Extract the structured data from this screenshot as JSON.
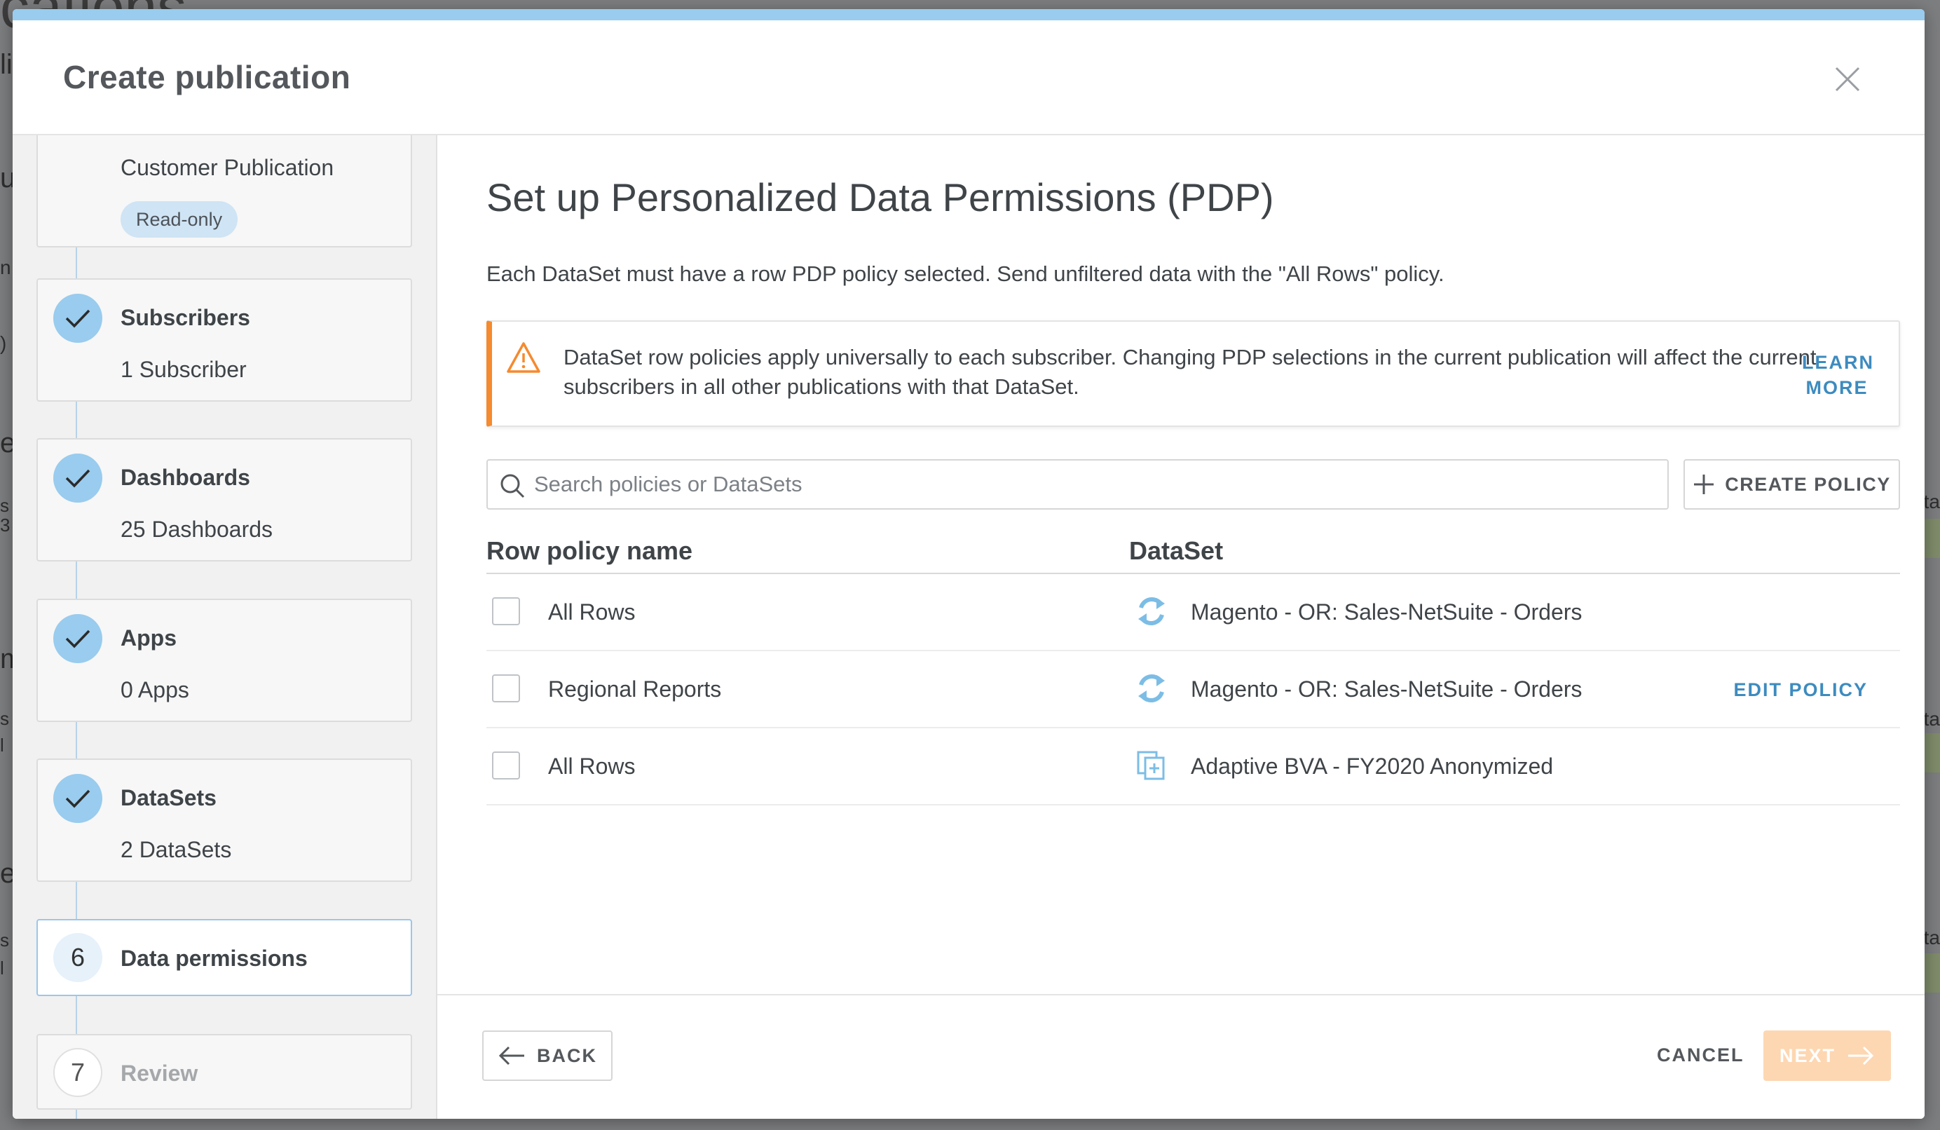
{
  "background": {
    "title_fragment": "cations",
    "side_fragments": [
      "li",
      "us",
      "n",
      ")",
      "e",
      "s",
      "3",
      "m",
      "s",
      "l",
      "el",
      "s",
      "l"
    ],
    "right_fragments": [
      "ta",
      "ld",
      "ta",
      "ld",
      "ta",
      "ld"
    ]
  },
  "modal": {
    "title": "Create publication"
  },
  "stepper": {
    "steps": [
      {
        "title": "",
        "subtitle": "Customer Publication",
        "badge": "Read-only",
        "state": "complete"
      },
      {
        "title": "Subscribers",
        "subtitle": "1 Subscriber",
        "state": "complete"
      },
      {
        "title": "Dashboards",
        "subtitle": "25 Dashboards",
        "state": "complete"
      },
      {
        "title": "Apps",
        "subtitle": "0 Apps",
        "state": "complete"
      },
      {
        "title": "DataSets",
        "subtitle": "2 DataSets",
        "state": "complete"
      },
      {
        "number": "6",
        "title": "Data permissions",
        "state": "active"
      },
      {
        "number": "7",
        "title": "Review",
        "state": "pending"
      }
    ]
  },
  "content": {
    "heading": "Set up Personalized Data Permissions (PDP)",
    "description": "Each DataSet must have a row PDP policy selected. Send unfiltered data with the \"All Rows\" policy.",
    "alert": {
      "text": "DataSet row policies apply universally to each subscriber. Changing PDP selections in the current publication will affect the current subscribers in all other publications with that DataSet.",
      "link_line1": "LEARN",
      "link_line2": "MORE"
    },
    "search": {
      "placeholder": "Search policies or DataSets",
      "value": ""
    },
    "create_policy_label": "CREATE POLICY",
    "table": {
      "columns": [
        "Row policy name",
        "DataSet"
      ],
      "rows": [
        {
          "policy": "All Rows",
          "dataset": "Magento - OR: Sales-NetSuite - Orders",
          "dataset_icon": "sync-dataset-icon",
          "checked": false,
          "action": ""
        },
        {
          "policy": "Regional Reports",
          "dataset": "Magento - OR: Sales-NetSuite - Orders",
          "dataset_icon": "sync-dataset-icon",
          "checked": false,
          "action": "EDIT POLICY"
        },
        {
          "policy": "All Rows",
          "dataset": "Adaptive BVA - FY2020 Anonymized",
          "dataset_icon": "copy-dataset-icon",
          "checked": false,
          "action": ""
        }
      ]
    }
  },
  "footer": {
    "back_label": "BACK",
    "cancel_label": "CANCEL",
    "next_label": "NEXT"
  },
  "colors": {
    "accent": "#99ccee",
    "warning": "#f58a2e",
    "link": "#3d8bbf",
    "next_disabled": "#fdd7b2"
  }
}
